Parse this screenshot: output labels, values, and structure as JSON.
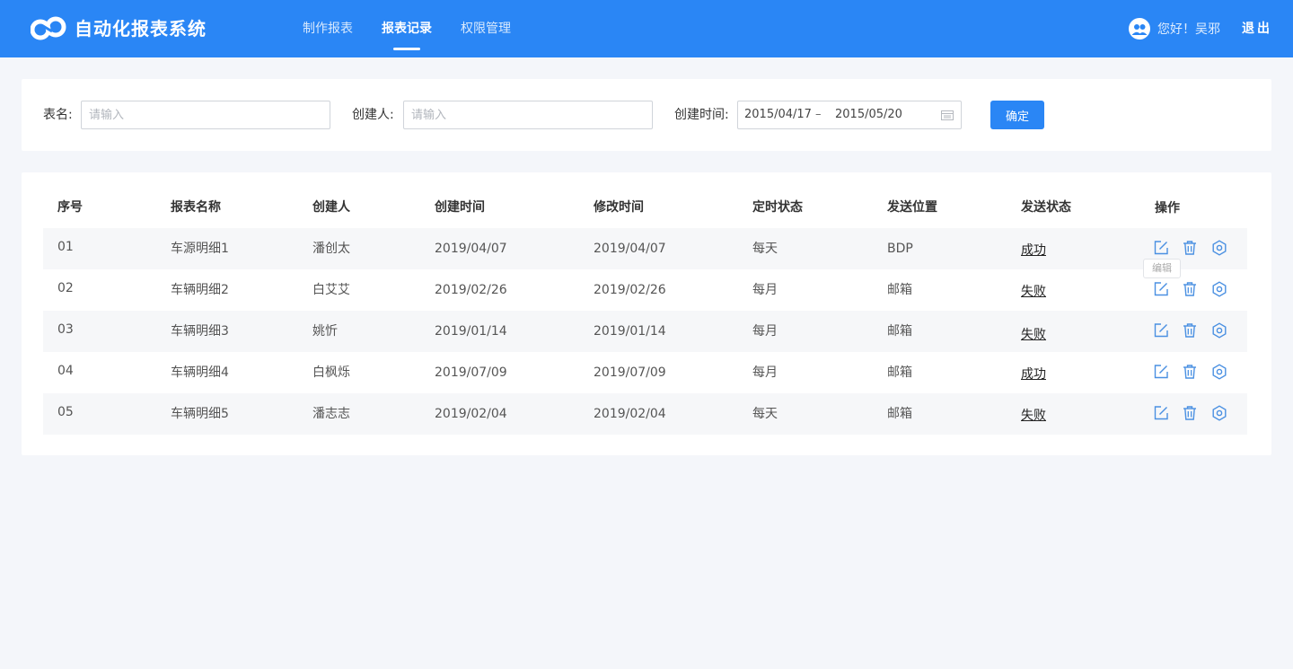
{
  "header": {
    "app_title": "自动化报表系统",
    "nav": [
      {
        "label": "制作报表",
        "active": false
      },
      {
        "label": "报表记录",
        "active": true
      },
      {
        "label": "权限管理",
        "active": false
      }
    ],
    "greeting": "您好！吴邪",
    "logout": "退出",
    "brand_color": "#2a86f5"
  },
  "filter": {
    "table_name_label": "表名:",
    "table_name_placeholder": "请输入",
    "creator_label": "创建人:",
    "creator_placeholder": "请输入",
    "created_time_label": "创建时间:",
    "date_start": "2015/04/17",
    "date_separator": "–",
    "date_end": "2015/05/20",
    "confirm_label": "确定"
  },
  "table": {
    "columns": [
      "序号",
      "报表名称",
      "创建人",
      "创建时间",
      "修改时间",
      "定时状态",
      "发送位置",
      "发送状态",
      "操作"
    ],
    "rows": [
      [
        "01",
        "车源明细1",
        "潘创太",
        "2019/04/07",
        "2019/04/07",
        "每天",
        "BDP",
        "成功"
      ],
      [
        "02",
        "车辆明细2",
        "白艾艾",
        "2019/02/26",
        "2019/02/26",
        "每月",
        "邮箱",
        "失败"
      ],
      [
        "03",
        "车辆明细3",
        "姚忻",
        "2019/01/14",
        "2019/01/14",
        "每月",
        "邮箱",
        "失败"
      ],
      [
        "04",
        "车辆明细4",
        "白枫烁",
        "2019/07/09",
        "2019/07/09",
        "每月",
        "邮箱",
        "成功"
      ],
      [
        "05",
        "车辆明细5",
        "潘志志",
        "2019/02/04",
        "2019/02/04",
        "每天",
        "邮箱",
        "失败"
      ]
    ],
    "tooltip": "编辑",
    "icons": [
      "edit-icon",
      "delete-icon",
      "settings-icon"
    ]
  }
}
